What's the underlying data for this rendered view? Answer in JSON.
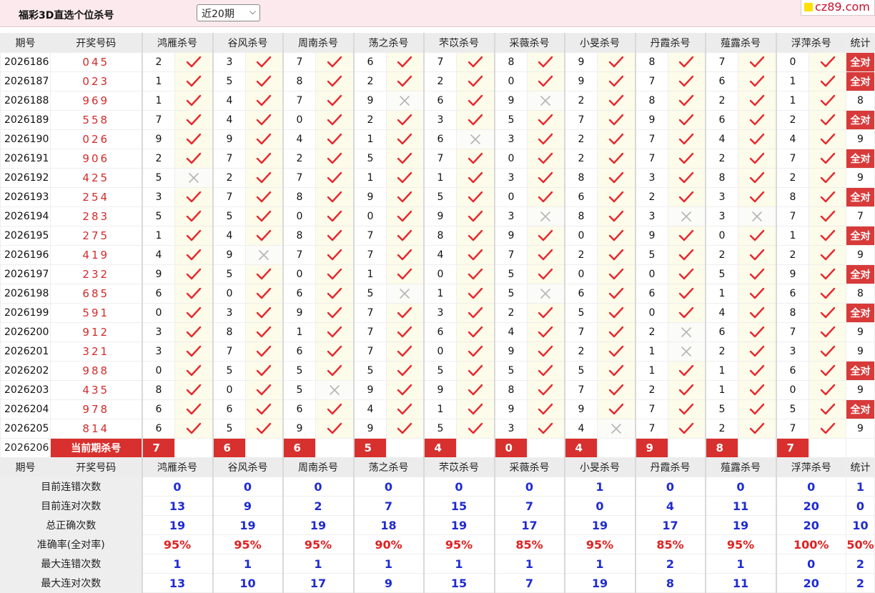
{
  "header": {
    "title": "福彩3D直选个位杀号",
    "period_select": "近20期",
    "site": "cz89.com"
  },
  "table": {
    "columns": [
      "期号",
      "开奖号码",
      "鸿雁杀号",
      "谷风杀号",
      "周南杀号",
      "荡之杀号",
      "芣苡杀号",
      "采薇杀号",
      "小旻杀号",
      "丹霞杀号",
      "薤露杀号",
      "浮萍杀号",
      "统计"
    ],
    "all_correct_label": "全对",
    "rows": [
      {
        "issue": "2026186",
        "draw": "045",
        "kills": [
          2,
          3,
          7,
          6,
          7,
          8,
          9,
          8,
          7,
          0
        ],
        "hits": [
          1,
          1,
          1,
          1,
          1,
          1,
          1,
          1,
          1,
          1
        ],
        "stat": "全对"
      },
      {
        "issue": "2026187",
        "draw": "023",
        "kills": [
          1,
          5,
          8,
          2,
          2,
          0,
          9,
          7,
          6,
          1
        ],
        "hits": [
          1,
          1,
          1,
          1,
          1,
          1,
          1,
          1,
          1,
          1
        ],
        "stat": "全对"
      },
      {
        "issue": "2026188",
        "draw": "969",
        "kills": [
          1,
          4,
          7,
          9,
          6,
          9,
          2,
          8,
          2,
          1
        ],
        "hits": [
          1,
          1,
          1,
          0,
          1,
          0,
          1,
          1,
          1,
          1
        ],
        "stat": "8"
      },
      {
        "issue": "2026189",
        "draw": "558",
        "kills": [
          7,
          4,
          0,
          2,
          3,
          5,
          7,
          9,
          6,
          2
        ],
        "hits": [
          1,
          1,
          1,
          1,
          1,
          1,
          1,
          1,
          1,
          1
        ],
        "stat": "全对"
      },
      {
        "issue": "2026190",
        "draw": "026",
        "kills": [
          9,
          9,
          4,
          1,
          6,
          3,
          2,
          7,
          4,
          4
        ],
        "hits": [
          1,
          1,
          1,
          1,
          0,
          1,
          1,
          1,
          1,
          1
        ],
        "stat": "9"
      },
      {
        "issue": "2026191",
        "draw": "906",
        "kills": [
          2,
          7,
          2,
          5,
          7,
          0,
          2,
          7,
          2,
          7
        ],
        "hits": [
          1,
          1,
          1,
          1,
          1,
          1,
          1,
          1,
          1,
          1
        ],
        "stat": "全对"
      },
      {
        "issue": "2026192",
        "draw": "425",
        "kills": [
          5,
          2,
          7,
          1,
          1,
          3,
          8,
          3,
          8,
          2
        ],
        "hits": [
          0,
          1,
          1,
          1,
          1,
          1,
          1,
          1,
          1,
          1
        ],
        "stat": "9"
      },
      {
        "issue": "2026193",
        "draw": "254",
        "kills": [
          3,
          7,
          8,
          9,
          5,
          0,
          6,
          2,
          3,
          8
        ],
        "hits": [
          1,
          1,
          1,
          1,
          1,
          1,
          1,
          1,
          1,
          1
        ],
        "stat": "全对"
      },
      {
        "issue": "2026194",
        "draw": "283",
        "kills": [
          5,
          5,
          0,
          0,
          9,
          3,
          8,
          3,
          3,
          7
        ],
        "hits": [
          1,
          1,
          1,
          1,
          1,
          0,
          1,
          0,
          0,
          1
        ],
        "stat": "7"
      },
      {
        "issue": "2026195",
        "draw": "275",
        "kills": [
          1,
          4,
          8,
          7,
          8,
          9,
          0,
          9,
          0,
          1
        ],
        "hits": [
          1,
          1,
          1,
          1,
          1,
          1,
          1,
          1,
          1,
          1
        ],
        "stat": "全对"
      },
      {
        "issue": "2026196",
        "draw": "419",
        "kills": [
          4,
          9,
          7,
          7,
          4,
          7,
          2,
          5,
          2,
          2
        ],
        "hits": [
          1,
          0,
          1,
          1,
          1,
          1,
          1,
          1,
          1,
          1
        ],
        "stat": "9"
      },
      {
        "issue": "2026197",
        "draw": "232",
        "kills": [
          9,
          5,
          0,
          1,
          0,
          5,
          0,
          0,
          5,
          9
        ],
        "hits": [
          1,
          1,
          1,
          1,
          1,
          1,
          1,
          1,
          1,
          1
        ],
        "stat": "全对"
      },
      {
        "issue": "2026198",
        "draw": "685",
        "kills": [
          6,
          0,
          6,
          5,
          1,
          5,
          6,
          6,
          1,
          6
        ],
        "hits": [
          1,
          1,
          1,
          0,
          1,
          0,
          1,
          1,
          1,
          1
        ],
        "stat": "8"
      },
      {
        "issue": "2026199",
        "draw": "591",
        "kills": [
          0,
          3,
          9,
          7,
          3,
          2,
          5,
          0,
          4,
          8
        ],
        "hits": [
          1,
          1,
          1,
          1,
          1,
          1,
          1,
          1,
          1,
          1
        ],
        "stat": "全对"
      },
      {
        "issue": "2026200",
        "draw": "912",
        "kills": [
          3,
          8,
          1,
          7,
          6,
          4,
          7,
          2,
          6,
          7
        ],
        "hits": [
          1,
          1,
          1,
          1,
          1,
          1,
          1,
          0,
          1,
          1
        ],
        "stat": "9"
      },
      {
        "issue": "2026201",
        "draw": "321",
        "kills": [
          3,
          7,
          6,
          7,
          0,
          9,
          2,
          1,
          2,
          3
        ],
        "hits": [
          1,
          1,
          1,
          1,
          1,
          1,
          1,
          0,
          1,
          1
        ],
        "stat": "9"
      },
      {
        "issue": "2026202",
        "draw": "988",
        "kills": [
          0,
          5,
          5,
          5,
          5,
          5,
          5,
          1,
          1,
          6
        ],
        "hits": [
          1,
          1,
          1,
          1,
          1,
          1,
          1,
          1,
          1,
          1
        ],
        "stat": "全对"
      },
      {
        "issue": "2026203",
        "draw": "435",
        "kills": [
          8,
          0,
          5,
          9,
          9,
          8,
          7,
          2,
          1,
          0
        ],
        "hits": [
          1,
          1,
          0,
          1,
          1,
          1,
          1,
          1,
          1,
          1
        ],
        "stat": "9"
      },
      {
        "issue": "2026204",
        "draw": "978",
        "kills": [
          6,
          6,
          6,
          4,
          1,
          9,
          9,
          7,
          5,
          5
        ],
        "hits": [
          1,
          1,
          1,
          1,
          1,
          1,
          1,
          1,
          1,
          1
        ],
        "stat": "全对"
      },
      {
        "issue": "2026205",
        "draw": "814",
        "kills": [
          6,
          5,
          9,
          9,
          5,
          3,
          4,
          7,
          2,
          7
        ],
        "hits": [
          1,
          1,
          1,
          1,
          1,
          1,
          0,
          1,
          1,
          1
        ],
        "stat": "9"
      }
    ],
    "current": {
      "issue": "2026206",
      "label": "当前期杀号",
      "kills": [
        7,
        6,
        6,
        5,
        4,
        0,
        4,
        9,
        8,
        7
      ]
    },
    "footer_header": [
      "期号",
      "开奖号码",
      "鸿雁杀号",
      "谷风杀号",
      "周南杀号",
      "荡之杀号",
      "芣苡杀号",
      "采薇杀号",
      "小旻杀号",
      "丹霞杀号",
      "薤露杀号",
      "浮萍杀号",
      "统计"
    ],
    "stats": [
      {
        "label": "目前连错次数",
        "values": [
          "0",
          "0",
          "0",
          "0",
          "0",
          "0",
          "1",
          "0",
          "0",
          "0",
          "1"
        ]
      },
      {
        "label": "目前连对次数",
        "values": [
          "13",
          "9",
          "2",
          "7",
          "15",
          "7",
          "0",
          "4",
          "11",
          "20",
          "0"
        ]
      },
      {
        "label": "总正确次数",
        "values": [
          "19",
          "19",
          "19",
          "18",
          "19",
          "17",
          "19",
          "17",
          "19",
          "20",
          "10"
        ]
      },
      {
        "label": "准确率(全对率)",
        "values": [
          "95%",
          "95%",
          "95%",
          "90%",
          "95%",
          "85%",
          "95%",
          "85%",
          "95%",
          "100%",
          "50%"
        ],
        "pct": true
      },
      {
        "label": "最大连错次数",
        "values": [
          "1",
          "1",
          "1",
          "1",
          "1",
          "1",
          "1",
          "2",
          "1",
          "0",
          "2"
        ]
      },
      {
        "label": "最大连对次数",
        "values": [
          "13",
          "10",
          "17",
          "9",
          "15",
          "7",
          "19",
          "8",
          "11",
          "20",
          "2"
        ]
      }
    ]
  },
  "colors": {
    "check": "#e8262d",
    "cross": "#b4b4b4",
    "accent_red": "#d8302e",
    "stat_blue": "#1f2bd0"
  }
}
